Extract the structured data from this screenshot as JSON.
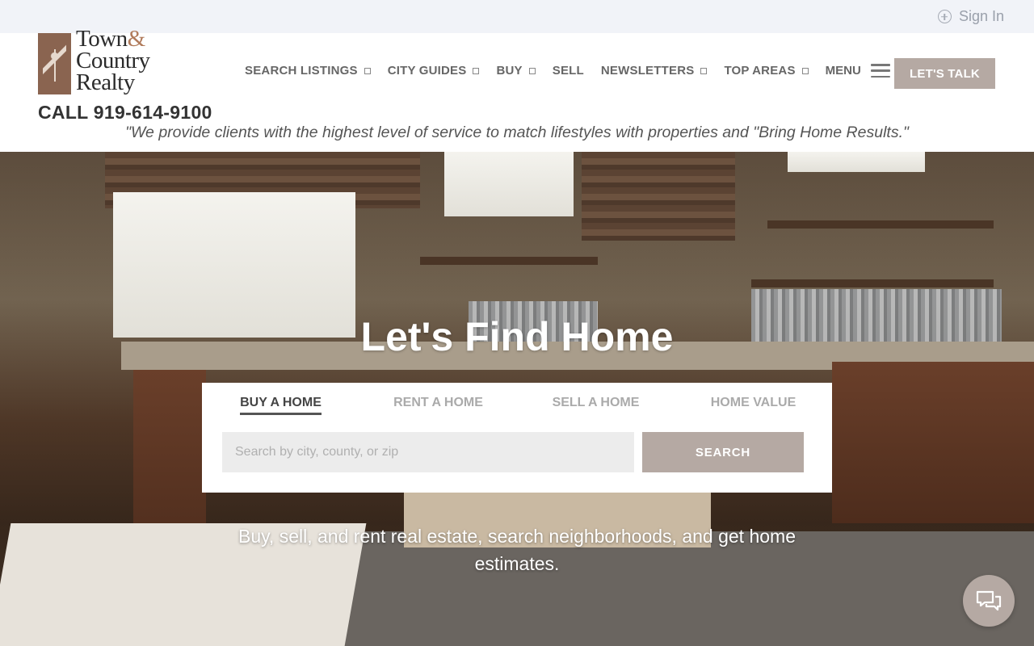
{
  "topbar": {
    "signin_label": "Sign In"
  },
  "header": {
    "logo": {
      "line1": "Town",
      "amp": "&",
      "line2": "Country",
      "line3": "Realty"
    },
    "call": "CALL 919-614-9100",
    "tagline": "\"We provide clients with the highest level of service to match lifestyles with properties and \"Bring Home Results.\""
  },
  "nav": {
    "items": [
      {
        "label": "SEARCH LISTINGS",
        "dropdown": true
      },
      {
        "label": "CITY GUIDES",
        "dropdown": true
      },
      {
        "label": "BUY",
        "dropdown": true
      },
      {
        "label": "SELL",
        "dropdown": false
      },
      {
        "label": "NEWSLETTERS",
        "dropdown": true
      },
      {
        "label": "TOP AREAS",
        "dropdown": true
      }
    ],
    "menu_label": "MENU",
    "cta_label": "LET'S TALK"
  },
  "hero": {
    "title": "Let's Find Home",
    "tabs": [
      {
        "label": "BUY A HOME",
        "active": true
      },
      {
        "label": "RENT A HOME",
        "active": false
      },
      {
        "label": "SELL A HOME",
        "active": false
      },
      {
        "label": "HOME VALUE",
        "active": false
      }
    ],
    "search": {
      "placeholder": "Search by city, county, or zip",
      "value": "",
      "button_label": "SEARCH"
    },
    "subtitle": "Buy, sell, and rent real estate, search neighborhoods, and get home estimates."
  },
  "icons": {
    "signin": "plus-circle-icon",
    "menu": "hamburger-icon",
    "chat": "chat-bubbles-icon",
    "caret": "chevron-down-icon"
  },
  "colors": {
    "accent": "#b5a9a3",
    "topbar_bg": "#f1f3f8",
    "nav_text": "#666666",
    "logo_brown": "#8a6450"
  }
}
